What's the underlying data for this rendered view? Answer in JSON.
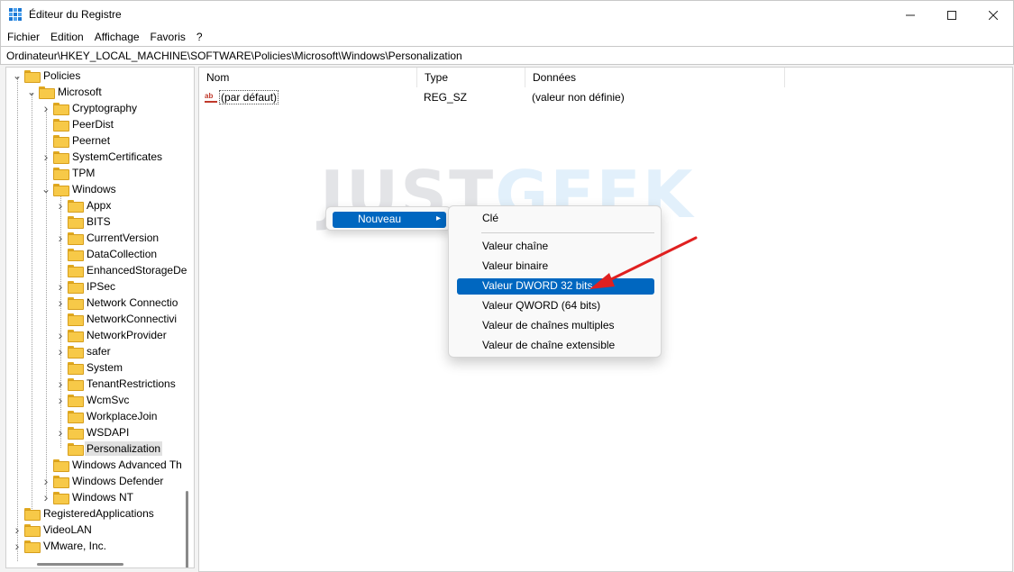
{
  "window": {
    "title": "Éditeur du Registre"
  },
  "menu": [
    "Fichier",
    "Edition",
    "Affichage",
    "Favoris",
    "?"
  ],
  "address": "Ordinateur\\HKEY_LOCAL_MACHINE\\SOFTWARE\\Policies\\Microsoft\\Windows\\Personalization",
  "tree": [
    {
      "label": "Policies",
      "level": 1,
      "expander": "open"
    },
    {
      "label": "Microsoft",
      "level": 2,
      "expander": "open"
    },
    {
      "label": "Cryptography",
      "level": 3,
      "expander": "closed"
    },
    {
      "label": "PeerDist",
      "level": 3,
      "expander": "none"
    },
    {
      "label": "Peernet",
      "level": 3,
      "expander": "none"
    },
    {
      "label": "SystemCertificates",
      "level": 3,
      "expander": "closed"
    },
    {
      "label": "TPM",
      "level": 3,
      "expander": "none"
    },
    {
      "label": "Windows",
      "level": 3,
      "expander": "open"
    },
    {
      "label": "Appx",
      "level": 4,
      "expander": "closed"
    },
    {
      "label": "BITS",
      "level": 4,
      "expander": "none"
    },
    {
      "label": "CurrentVersion",
      "level": 4,
      "expander": "closed"
    },
    {
      "label": "DataCollection",
      "level": 4,
      "expander": "none"
    },
    {
      "label": "EnhancedStorageDe",
      "level": 4,
      "expander": "none"
    },
    {
      "label": "IPSec",
      "level": 4,
      "expander": "closed"
    },
    {
      "label": "Network Connectio",
      "level": 4,
      "expander": "closed"
    },
    {
      "label": "NetworkConnectivi",
      "level": 4,
      "expander": "none"
    },
    {
      "label": "NetworkProvider",
      "level": 4,
      "expander": "closed"
    },
    {
      "label": "safer",
      "level": 4,
      "expander": "closed"
    },
    {
      "label": "System",
      "level": 4,
      "expander": "none"
    },
    {
      "label": "TenantRestrictions",
      "level": 4,
      "expander": "closed"
    },
    {
      "label": "WcmSvc",
      "level": 4,
      "expander": "closed"
    },
    {
      "label": "WorkplaceJoin",
      "level": 4,
      "expander": "none"
    },
    {
      "label": "WSDAPI",
      "level": 4,
      "expander": "closed"
    },
    {
      "label": "Personalization",
      "level": 4,
      "expander": "none",
      "selected": true
    },
    {
      "label": "Windows Advanced Th",
      "level": 3,
      "expander": "none"
    },
    {
      "label": "Windows Defender",
      "level": 3,
      "expander": "closed"
    },
    {
      "label": "Windows NT",
      "level": 3,
      "expander": "closed"
    },
    {
      "label": "RegisteredApplications",
      "level": 1,
      "expander": "none"
    },
    {
      "label": "VideoLAN",
      "level": 1,
      "expander": "closed"
    },
    {
      "label": "VMware, Inc.",
      "level": 1,
      "expander": "closed"
    }
  ],
  "list": {
    "columns": [
      "Nom",
      "Type",
      "Données"
    ],
    "rows": [
      {
        "name": "(par défaut)",
        "type": "REG_SZ",
        "data": "(valeur non définie)"
      }
    ]
  },
  "watermark": {
    "part1": "JUST",
    "part2": "GEEK"
  },
  "context_menu": {
    "parent_item": "Nouveau",
    "submenu": [
      "Clé",
      "Valeur chaîne",
      "Valeur binaire",
      "Valeur DWORD 32 bits",
      "Valeur QWORD (64 bits)",
      "Valeur de chaînes multiples",
      "Valeur de chaîne extensible"
    ],
    "highlighted": "Valeur DWORD 32 bits"
  },
  "colors": {
    "accent": "#0067c0",
    "annotation_arrow": "#e02020"
  },
  "icons": [
    "registry-app-icon",
    "folder-icon",
    "chevron-right-icon",
    "chevron-down-icon",
    "string-value-icon"
  ]
}
